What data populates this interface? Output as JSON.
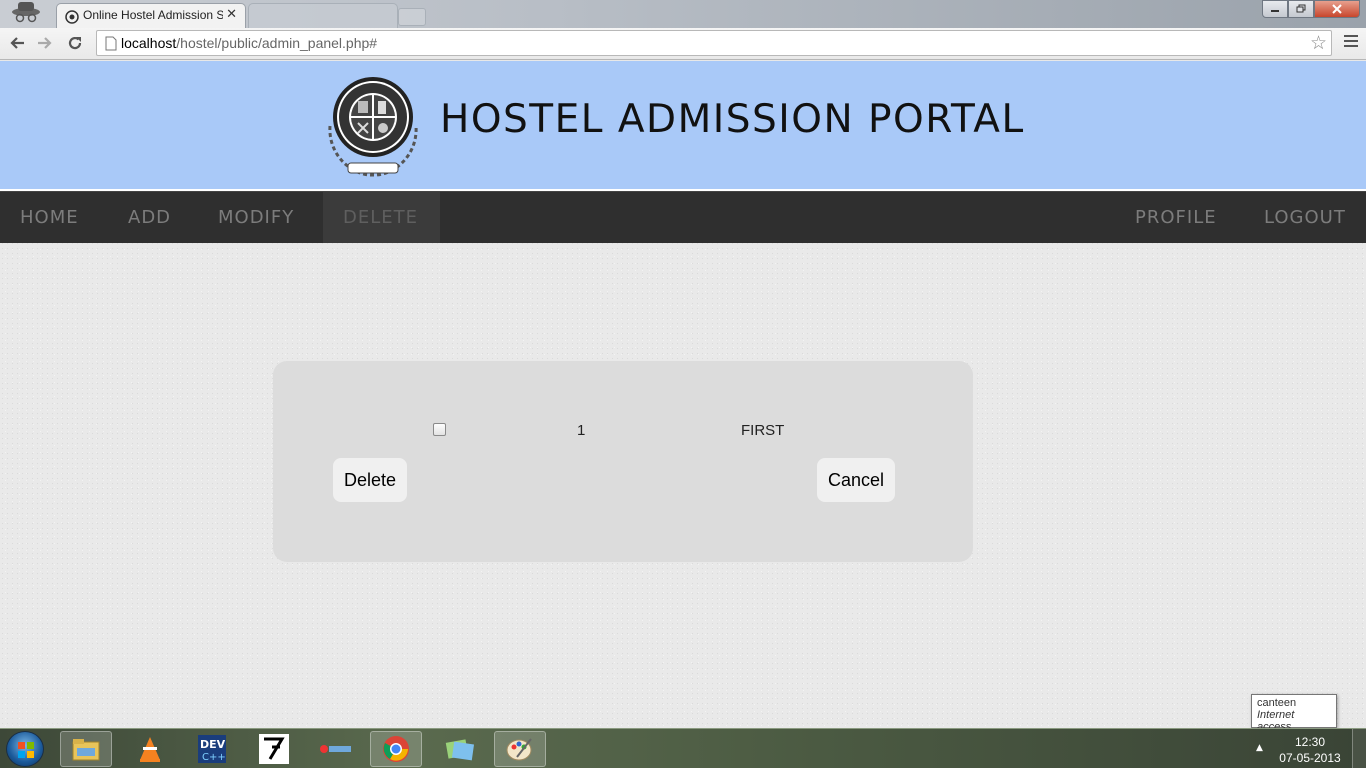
{
  "browser": {
    "active_tab_title": "Online Hostel Admission S",
    "inactive_tab_title": "",
    "tab_close_glyph": "✕",
    "url_host": "localhost",
    "url_path": "/hostel/public/admin_panel.php#",
    "star_glyph": "☆"
  },
  "header": {
    "title": "HOSTEL ADMISSION PORTAL",
    "logo_icon": "institute-seal-icon",
    "background": "#a9c9f8"
  },
  "nav": {
    "left": [
      {
        "label": "HOME"
      },
      {
        "label": "ADD"
      },
      {
        "label": "MODIFY"
      },
      {
        "label": "DELETE",
        "active": true
      }
    ],
    "right": [
      {
        "label": "PROFILE"
      },
      {
        "label": "LOGOUT"
      }
    ]
  },
  "record": {
    "checked": false,
    "id": "1",
    "name": "FIRST"
  },
  "actions": {
    "delete_label": "Delete",
    "cancel_label": "Cancel"
  },
  "tooltip": {
    "network": "canteen",
    "status": "Internet access"
  },
  "taskbar": {
    "apps": [
      "file-explorer-icon",
      "vlc-icon",
      "devcpp-icon",
      "app-icon",
      "bestel-icon",
      "chrome-icon",
      "folder-icon",
      "paint-icon"
    ],
    "time": "12:30",
    "date": "07-05-2013"
  }
}
